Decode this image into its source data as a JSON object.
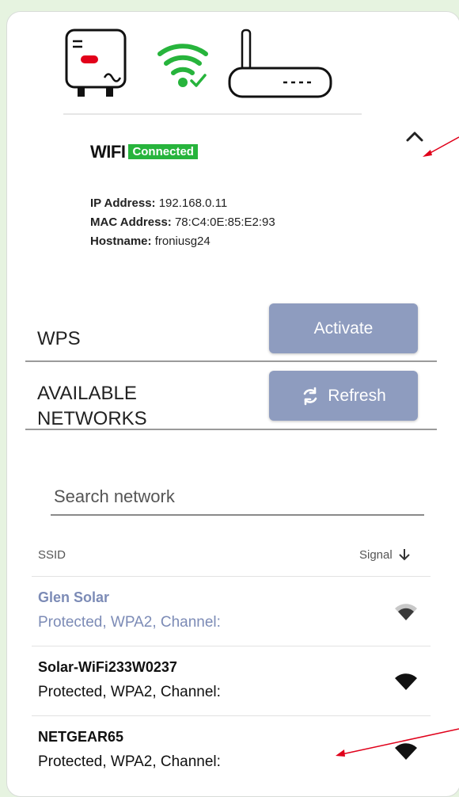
{
  "wifi": {
    "title": "WIFI",
    "status": "Connected",
    "ip_label": "IP Address:",
    "ip_value": "192.168.0.11",
    "mac_label": "MAC Address:",
    "mac_value": "78:C4:0E:85:E2:93",
    "hostname_label": "Hostname:",
    "hostname_value": "froniusg24"
  },
  "wps": {
    "label": "WPS",
    "button": "Activate"
  },
  "available": {
    "label_line1": "AVAILABLE",
    "label_line2": "NETWORKS",
    "button": "Refresh"
  },
  "search": {
    "placeholder": "Search network"
  },
  "table": {
    "col_ssid": "SSID",
    "col_signal": "Signal",
    "networks": [
      {
        "name": "Glen Solar",
        "detail": "Protected, WPA2, Channel:",
        "state": "selected",
        "signal_icon": "wifi-signal-icon"
      },
      {
        "name": "Solar-WiFi233W0237",
        "detail": "Protected, WPA2, Channel:",
        "state": "normal",
        "signal_icon": "wifi-signal-icon"
      },
      {
        "name": "NETGEAR65",
        "detail": "Protected, WPA2, Channel:",
        "state": "normal",
        "signal_icon": "wifi-signal-icon"
      }
    ]
  },
  "colors": {
    "background": "#e6f3e0",
    "connected_green": "#27b43c",
    "button_blue": "#8e9cbf",
    "selected_text": "#7c8bb6",
    "annotation_arrow": "#e0001a"
  },
  "icons": [
    "inverter-icon",
    "wifi-connected-icon",
    "router-icon",
    "chevron-up-icon",
    "refresh-icon",
    "sort-down-icon",
    "wifi-signal-icon"
  ]
}
